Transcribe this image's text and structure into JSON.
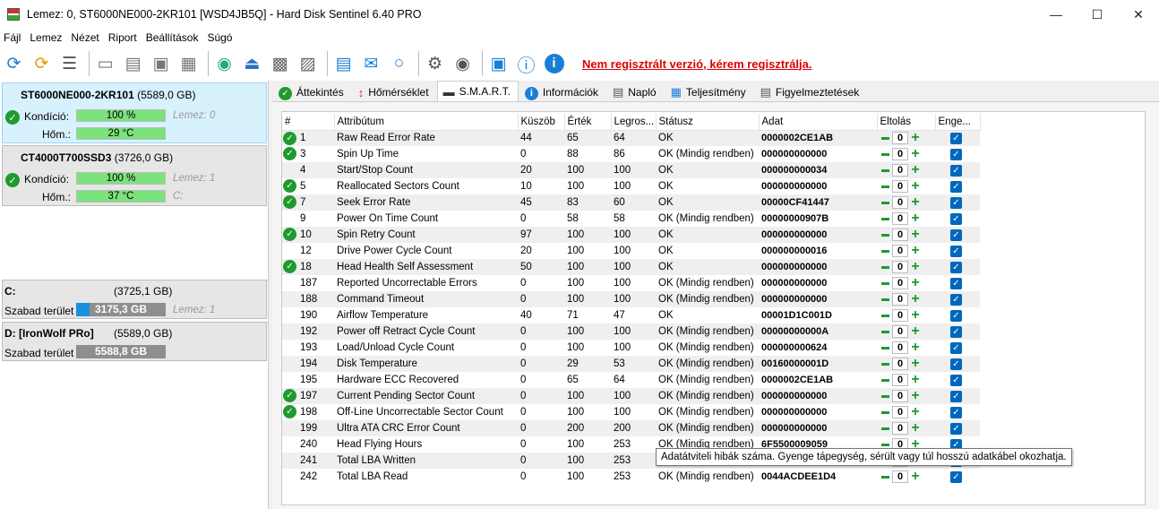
{
  "window": {
    "title": "Lemez: 0, ST6000NE000-2KR101 [WSD4JB5Q]  -  Hard Disk Sentinel 6.40 PRO"
  },
  "menu": [
    {
      "name": "menu-file",
      "label": "Fájl"
    },
    {
      "name": "menu-disk",
      "label": "Lemez"
    },
    {
      "name": "menu-view",
      "label": "Nézet"
    },
    {
      "name": "menu-report",
      "label": "Riport"
    },
    {
      "name": "menu-settings",
      "label": "Beállítások"
    },
    {
      "name": "menu-help",
      "label": "Súgó"
    }
  ],
  "toolbar": {
    "register_link": "Nem regisztrált verzió, kérem regisztrálja."
  },
  "disks": [
    {
      "name": "ST6000NE000-2KR101",
      "size": "(5589,0 GB)",
      "condition_label": "Kondíció:",
      "condition": "100 %",
      "condition_value": 100,
      "temp_label": "Hőm.:",
      "temp": "29 °C",
      "extra1": "Lemez: 0",
      "extra2": ""
    },
    {
      "name": "CT4000T700SSD3",
      "size": "(3726,0 GB)",
      "condition_label": "Kondíció:",
      "condition": "100 %",
      "condition_value": 100,
      "temp_label": "Hőm.:",
      "temp": "37 °C",
      "extra1": "Lemez: 1",
      "extra2": "C:"
    }
  ],
  "volumes": [
    {
      "name": "C:",
      "size": "(3725,1 GB)",
      "free_label": "Szabad terület",
      "free": "3175,3 GB",
      "used_fraction": 0.15,
      "extra": "Lemez: 1"
    },
    {
      "name": "D: [IronWolf PRo]",
      "size": "(5589,0 GB)",
      "free_label": "Szabad terület",
      "free": "5588,8 GB",
      "used_fraction": 0.0,
      "extra": ""
    }
  ],
  "tabs": [
    {
      "name": "tab-overview",
      "label": "Áttekintés",
      "icon": "check-icon"
    },
    {
      "name": "tab-temperature",
      "label": "Hőmérséklet",
      "icon": "thermometer-icon"
    },
    {
      "name": "tab-smart",
      "label": "S.M.A.R.T.",
      "icon": "disk-icon"
    },
    {
      "name": "tab-info",
      "label": "Információk",
      "icon": "info-icon"
    },
    {
      "name": "tab-log",
      "label": "Napló",
      "icon": "log-icon"
    },
    {
      "name": "tab-performance",
      "label": "Teljesítmény",
      "icon": "chart-icon"
    },
    {
      "name": "tab-alerts",
      "label": "Figyelmeztetések",
      "icon": "alert-icon"
    }
  ],
  "smart": {
    "columns": [
      "#",
      "Attribútum",
      "Küszöb",
      "Érték",
      "Legros...",
      "Státusz",
      "Adat",
      "Eltolás",
      "Enge..."
    ],
    "rows": [
      {
        "ok": true,
        "id": "1",
        "attr": "Raw Read Error Rate",
        "thr": "44",
        "val": "65",
        "worst": "64",
        "status": "OK",
        "data": "0000002CE1AB",
        "offset": "0"
      },
      {
        "ok": true,
        "id": "3",
        "attr": "Spin Up Time",
        "thr": "0",
        "val": "88",
        "worst": "86",
        "status": "OK (Mindig rendben)",
        "data": "000000000000",
        "offset": "0"
      },
      {
        "ok": false,
        "id": "4",
        "attr": "Start/Stop Count",
        "thr": "20",
        "val": "100",
        "worst": "100",
        "status": "OK",
        "data": "000000000034",
        "offset": "0"
      },
      {
        "ok": true,
        "id": "5",
        "attr": "Reallocated Sectors Count",
        "thr": "10",
        "val": "100",
        "worst": "100",
        "status": "OK",
        "data": "000000000000",
        "offset": "0"
      },
      {
        "ok": true,
        "id": "7",
        "attr": "Seek Error Rate",
        "thr": "45",
        "val": "83",
        "worst": "60",
        "status": "OK",
        "data": "00000CF41447",
        "offset": "0"
      },
      {
        "ok": false,
        "id": "9",
        "attr": "Power On Time Count",
        "thr": "0",
        "val": "58",
        "worst": "58",
        "status": "OK (Mindig rendben)",
        "data": "00000000907B",
        "offset": "0"
      },
      {
        "ok": true,
        "id": "10",
        "attr": "Spin Retry Count",
        "thr": "97",
        "val": "100",
        "worst": "100",
        "status": "OK",
        "data": "000000000000",
        "offset": "0"
      },
      {
        "ok": false,
        "id": "12",
        "attr": "Drive Power Cycle Count",
        "thr": "20",
        "val": "100",
        "worst": "100",
        "status": "OK",
        "data": "000000000016",
        "offset": "0"
      },
      {
        "ok": true,
        "id": "18",
        "attr": "Head Health Self Assessment",
        "thr": "50",
        "val": "100",
        "worst": "100",
        "status": "OK",
        "data": "000000000000",
        "offset": "0"
      },
      {
        "ok": false,
        "id": "187",
        "attr": "Reported Uncorrectable Errors",
        "thr": "0",
        "val": "100",
        "worst": "100",
        "status": "OK (Mindig rendben)",
        "data": "000000000000",
        "offset": "0"
      },
      {
        "ok": false,
        "id": "188",
        "attr": "Command Timeout",
        "thr": "0",
        "val": "100",
        "worst": "100",
        "status": "OK (Mindig rendben)",
        "data": "000000000000",
        "offset": "0"
      },
      {
        "ok": false,
        "id": "190",
        "attr": "Airflow Temperature",
        "thr": "40",
        "val": "71",
        "worst": "47",
        "status": "OK",
        "data": "00001D1C001D",
        "offset": "0"
      },
      {
        "ok": false,
        "id": "192",
        "attr": "Power off Retract Cycle Count",
        "thr": "0",
        "val": "100",
        "worst": "100",
        "status": "OK (Mindig rendben)",
        "data": "00000000000A",
        "offset": "0"
      },
      {
        "ok": false,
        "id": "193",
        "attr": "Load/Unload Cycle Count",
        "thr": "0",
        "val": "100",
        "worst": "100",
        "status": "OK (Mindig rendben)",
        "data": "000000000624",
        "offset": "0"
      },
      {
        "ok": false,
        "id": "194",
        "attr": "Disk Temperature",
        "thr": "0",
        "val": "29",
        "worst": "53",
        "status": "OK (Mindig rendben)",
        "data": "00160000001D",
        "offset": "0"
      },
      {
        "ok": false,
        "id": "195",
        "attr": "Hardware ECC Recovered",
        "thr": "0",
        "val": "65",
        "worst": "64",
        "status": "OK (Mindig rendben)",
        "data": "0000002CE1AB",
        "offset": "0"
      },
      {
        "ok": true,
        "id": "197",
        "attr": "Current Pending Sector Count",
        "thr": "0",
        "val": "100",
        "worst": "100",
        "status": "OK (Mindig rendben)",
        "data": "000000000000",
        "offset": "0"
      },
      {
        "ok": true,
        "id": "198",
        "attr": "Off-Line Uncorrectable Sector Count",
        "thr": "0",
        "val": "100",
        "worst": "100",
        "status": "OK (Mindig rendben)",
        "data": "000000000000",
        "offset": "0"
      },
      {
        "ok": false,
        "id": "199",
        "attr": "Ultra ATA CRC Error Count",
        "thr": "0",
        "val": "200",
        "worst": "200",
        "status": "OK (Mindig rendben)",
        "data": "000000000000",
        "offset": "0"
      },
      {
        "ok": false,
        "id": "240",
        "attr": "Head Flying Hours",
        "thr": "0",
        "val": "100",
        "worst": "253",
        "status": "OK (Mindig rendben)",
        "data": "6F5500009059",
        "offset": "0"
      },
      {
        "ok": false,
        "id": "241",
        "attr": "Total LBA Written",
        "thr": "0",
        "val": "100",
        "worst": "253",
        "status": "",
        "data": "",
        "offset": "0"
      },
      {
        "ok": false,
        "id": "242",
        "attr": "Total LBA Read",
        "thr": "0",
        "val": "100",
        "worst": "253",
        "status": "OK (Mindig rendben)",
        "data": "0044ACDEE1D4",
        "offset": "0"
      }
    ]
  },
  "tooltip": "Adatátviteli hibák száma. Gyenge tápegység, sérült vagy túl hosszú adatkábel okozhatja.",
  "colors": {
    "ok_green": "#1e9a2e",
    "bar_green": "#7ce27c",
    "link_red": "#dd0000",
    "selected_bg": "#d7f1fd"
  }
}
